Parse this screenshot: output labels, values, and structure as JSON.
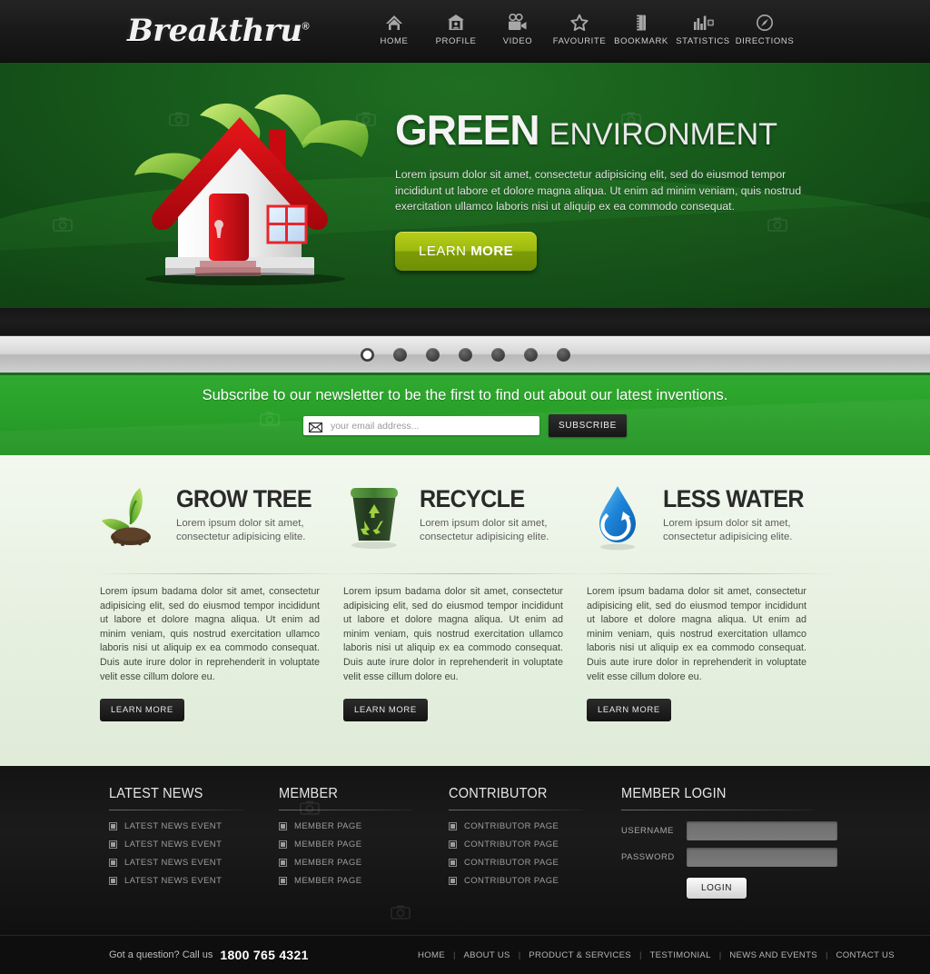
{
  "header": {
    "logo_text": "Breakthru",
    "logo_tm": "®",
    "nav": [
      {
        "label": "HOME",
        "icon": "home-icon"
      },
      {
        "label": "PROFILE",
        "icon": "profile-icon"
      },
      {
        "label": "VIDEO",
        "icon": "video-camera-icon"
      },
      {
        "label": "FAVOURITE",
        "icon": "star-icon"
      },
      {
        "label": "BOOKMARK",
        "icon": "bookmark-icon"
      },
      {
        "label": "STATISTICS",
        "icon": "bar-chart-icon"
      },
      {
        "label": "DIRECTIONS",
        "icon": "compass-icon"
      }
    ]
  },
  "hero": {
    "title_strong": "GREEN",
    "title_light": "ENVIRONMENT",
    "description": "Lorem ipsum dolor sit amet, consectetur adipisicing elit, sed do eiusmod tempor incididunt ut labore et dolore magna aliqua. Ut enim ad minim veniam, quis nostrud exercitation ullamco laboris nisi ut aliquip ex ea commodo consequat.",
    "cta_light": "LEARN ",
    "cta_bold": "MORE",
    "image": "green-house-with-leaves",
    "slider_dots": 7,
    "slider_active_index": 0,
    "accent_green": "#1a6b1f",
    "cta_color": "#9dba10"
  },
  "newsletter": {
    "title": "Subscribe to our newsletter to be the first to find out about our latest inventions.",
    "email_placeholder": "your email address...",
    "email_value": "",
    "subscribe_label": "SUBSCRIBE",
    "background": "#29a029"
  },
  "features": [
    {
      "icon": "sprout-plant-icon",
      "title": "GROW TREE",
      "subtitle": "Lorem ipsum dolor sit amet, consectetur adipisicing elite.",
      "body": "Lorem ipsum badama dolor sit amet, consectetur adipisicing elit, sed do eiusmod tempor incididunt ut labore et dolore magna aliqua. Ut enim ad minim veniam, quis nostrud exercitation ullamco laboris nisi ut aliquip ex ea commodo consequat. Duis aute irure dolor in reprehenderit in voluptate velit esse cillum dolore eu.",
      "button_label": "LEARN MORE"
    },
    {
      "icon": "recycle-bin-icon",
      "title": "RECYCLE",
      "subtitle": "Lorem ipsum dolor sit amet, consectetur adipisicing elite.",
      "body": "Lorem ipsum badama dolor sit amet, consectetur adipisicing elit, sed do eiusmod tempor incididunt ut labore et dolore magna aliqua. Ut enim ad minim veniam, quis nostrud exercitation ullamco laboris nisi ut aliquip ex ea commodo consequat. Duis aute irure dolor in reprehenderit in voluptate velit esse cillum dolore eu.",
      "button_label": "LEARN MORE"
    },
    {
      "icon": "water-drop-recycle-icon",
      "title": "LESS WATER",
      "subtitle": "Lorem ipsum dolor sit amet, consectetur adipisicing elite.",
      "body": "Lorem ipsum badama dolor sit amet, consectetur adipisicing elit, sed do eiusmod tempor incididunt ut labore et dolore magna aliqua. Ut enim ad minim veniam, quis nostrud exercitation ullamco laboris nisi ut aliquip ex ea commodo consequat. Duis aute irure dolor in reprehenderit in voluptate velit esse cillum dolore eu.",
      "button_label": "LEARN MORE"
    }
  ],
  "footer": {
    "latest_news": {
      "title": "LATEST NEWS",
      "items": [
        "LATEST NEWS EVENT",
        "LATEST NEWS EVENT",
        "LATEST NEWS EVENT",
        "LATEST NEWS EVENT"
      ]
    },
    "member": {
      "title": "MEMBER",
      "items": [
        "MEMBER PAGE",
        "MEMBER PAGE",
        "MEMBER PAGE",
        "MEMBER PAGE"
      ]
    },
    "contributor": {
      "title": "CONTRIBUTOR",
      "items": [
        "CONTRIBUTOR PAGE",
        "CONTRIBUTOR PAGE",
        "CONTRIBUTOR PAGE",
        "CONTRIBUTOR PAGE"
      ]
    },
    "login": {
      "title": "MEMBER LOGIN",
      "username_label": "USERNAME",
      "username_value": "",
      "password_label": "PASSWORD",
      "password_value": "",
      "button_label": "LOGIN"
    }
  },
  "bottombar": {
    "call_text": "Got a question? Call us",
    "phone": "1800 765 4321",
    "links": [
      "HOME",
      "ABOUT US",
      "PRODUCT & SERVICES",
      "TESTIMONIAL",
      "NEWS AND EVENTS",
      "CONTACT US"
    ],
    "separator": "|"
  }
}
